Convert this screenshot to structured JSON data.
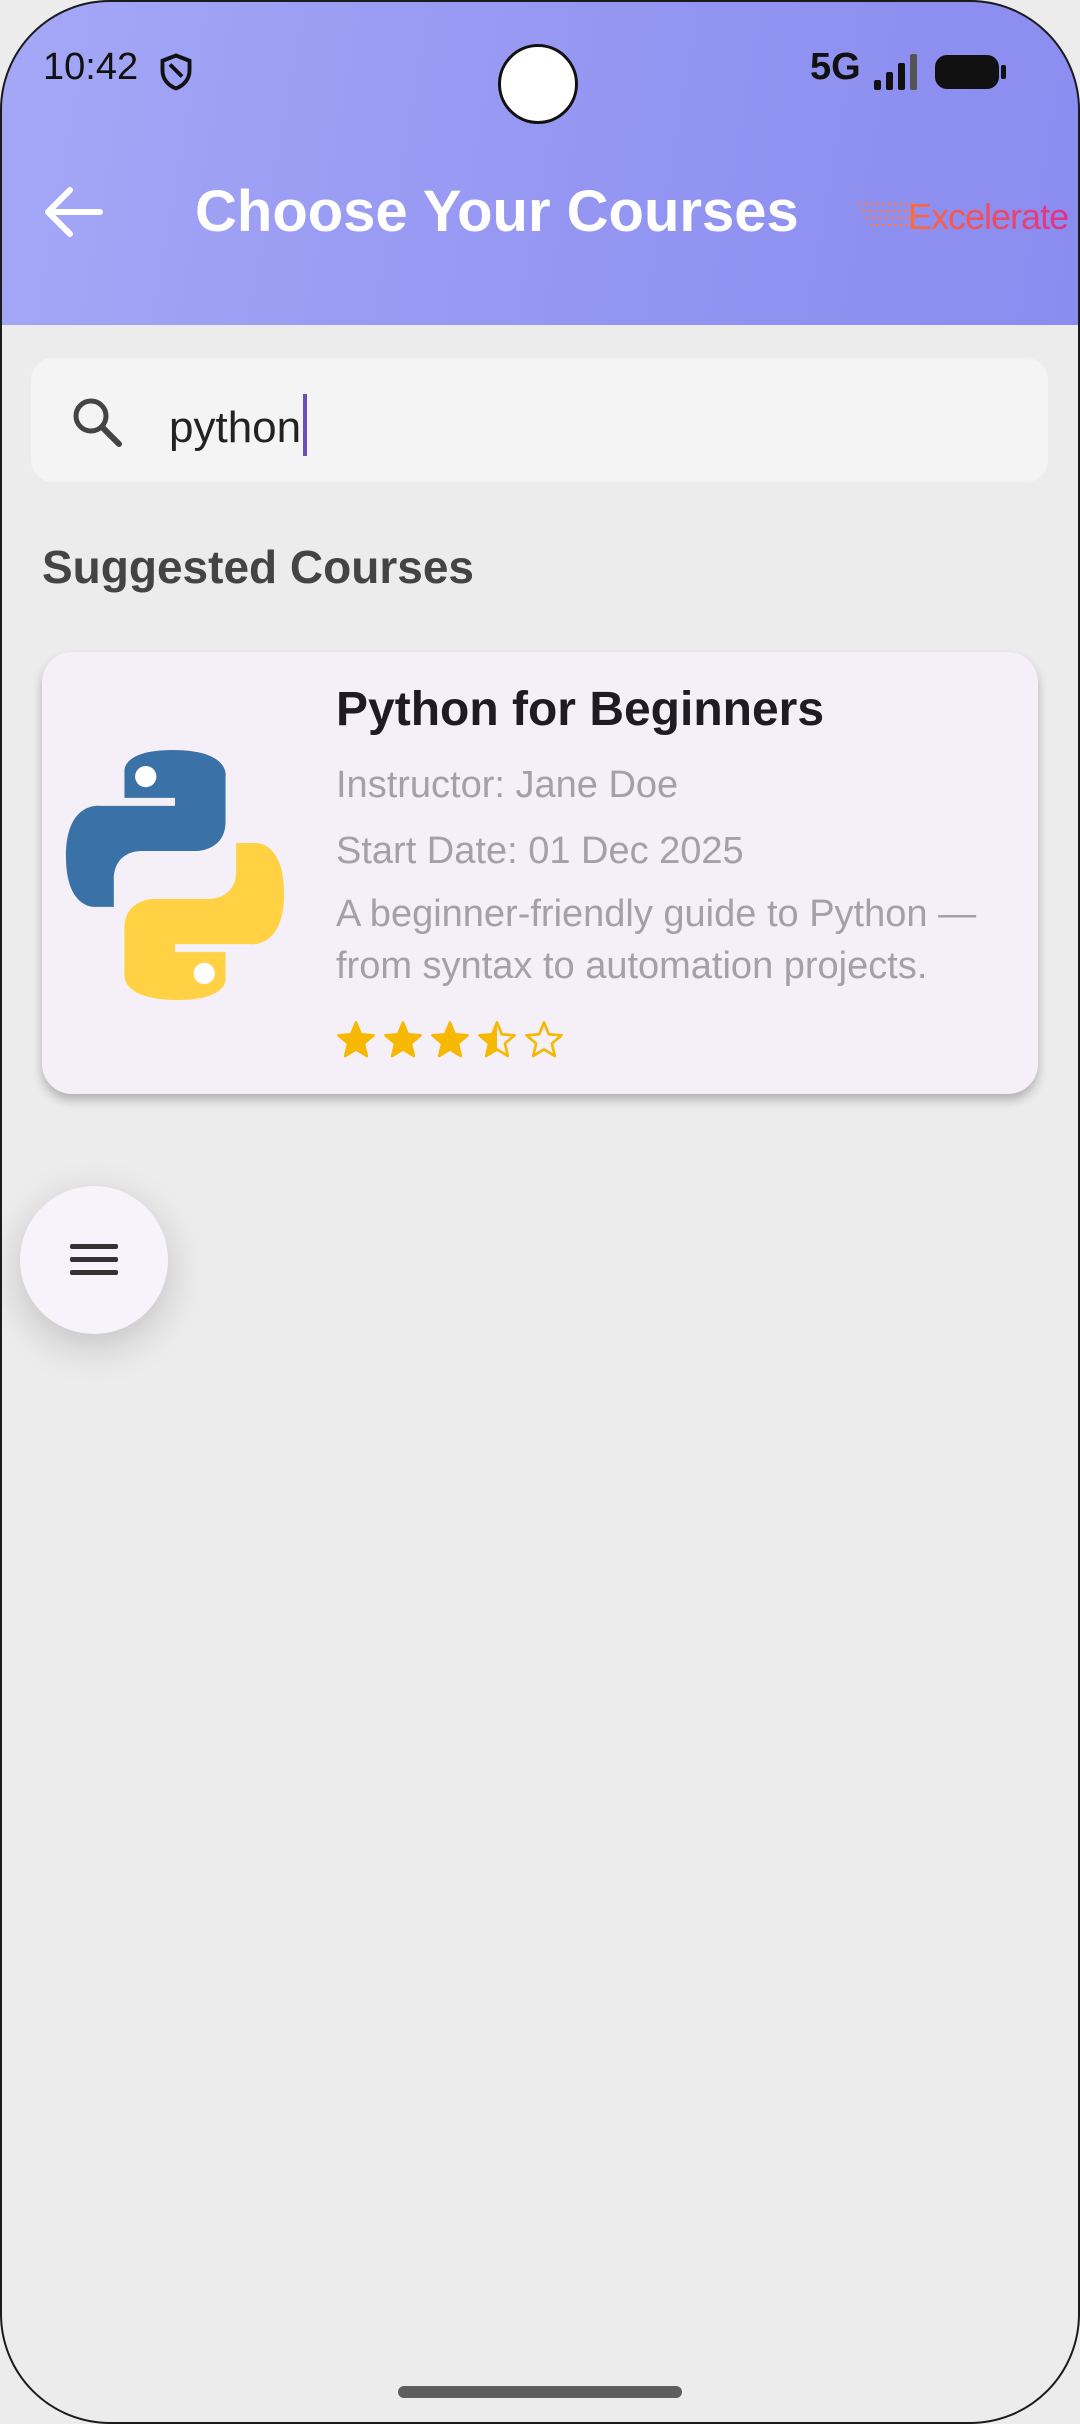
{
  "status_bar": {
    "time": "10:42",
    "network": "5G",
    "icons": [
      "shield-icon",
      "signal-icon",
      "battery-icon"
    ]
  },
  "header": {
    "title": "Choose Your Courses",
    "back_icon": "arrow-left-icon",
    "logo_text": "Excelerate"
  },
  "search": {
    "value": "python",
    "icon": "search-icon"
  },
  "section_title": "Suggested Courses",
  "courses": [
    {
      "title": "Python for Beginners",
      "instructor": "Instructor: Jane Doe",
      "start_date": "Start Date: 01 Dec 2025",
      "description": "A beginner-friendly guide to Python — from syntax to automation projects.",
      "rating": 3.5,
      "rating_max": 5,
      "logo": "python-logo"
    }
  ],
  "fab_icon": "menu-icon",
  "colors": {
    "header_start": "#a5a7f6",
    "header_end": "#8a8cf0",
    "star": "#f6b800",
    "caret": "#6b4fb5",
    "logo_gradient": [
      "#ff6a3a",
      "#e0308a"
    ]
  }
}
